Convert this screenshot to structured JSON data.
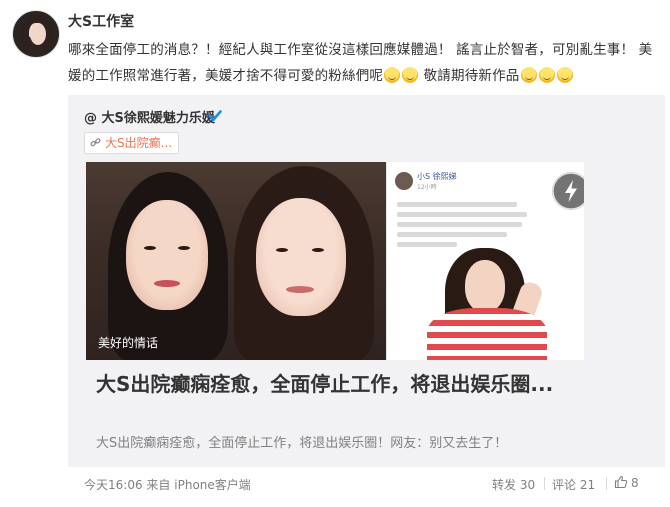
{
  "author": {
    "name": "大S工作室"
  },
  "post": {
    "text_part1": "哪來全面停工的消息？！經紀人與工作室從沒這樣回應媒體過！ 謠言止於智者，可別亂生事！ 美媛的工作照常進行著，美媛才捨不得可愛的粉絲們呢",
    "text_part2": " 敬請期待新作品"
  },
  "forward": {
    "author": "@ 大S徐熙媛魅力乐媛",
    "topic_tag": "大S出院癫...",
    "photo_caption": "美好的情话",
    "fb_name": "小S 徐熙娣",
    "fb_meta": "12小時",
    "article_title": "大S出院癫痫痊愈，全面停止工作，将退出娱乐圈...",
    "article_summary": "大S出院癫痫痊愈，全面停止工作，将退出娱乐圈！网友：别又去生了！"
  },
  "footer": {
    "time": "今天16:06",
    "from": "来自",
    "client": "iPhone客户端",
    "repost_label": "转发 30",
    "comment_label": "评论 21",
    "like_count": "8"
  },
  "colors": {
    "tag_orange": "#eb7350",
    "verified_blue": "#1a8ded",
    "card_bg": "#f2f2f5"
  }
}
